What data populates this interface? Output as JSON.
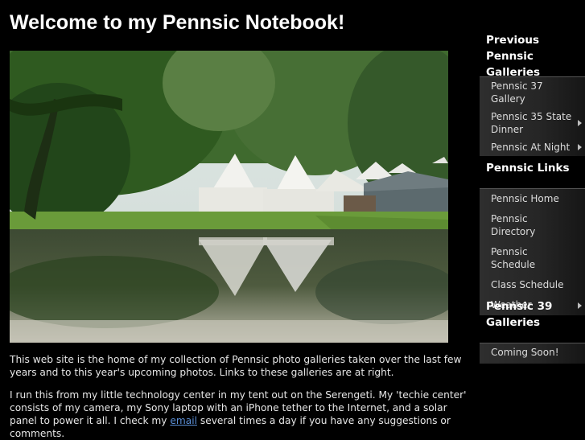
{
  "page": {
    "title": "Welcome to my Pennsic Notebook!",
    "photo_description": "Medieval tents reflected in a pond"
  },
  "intro": {
    "paragraph1": "This web site is the home of my collection of Pennsic photo galleries taken over the last few years and to this year's upcoming photos. Links to these galleries are at right.",
    "paragraph2_before_link": "I run this from my little technology center in my tent out on the Serengeti. My 'techie center' consists of my camera, my Sony laptop with an iPhone tether to the Internet, and a solar panel to power it all. I check my ",
    "paragraph2_link": "email",
    "paragraph2_after_link": " several times a day if you have any suggestions or comments."
  },
  "sidebar": {
    "previous_galleries": {
      "heading": "Previous Pennsic Galleries",
      "items": [
        {
          "label": "Pennsic 37 Gallery",
          "has_submenu": false
        },
        {
          "label": "Pennsic 35 State Dinner",
          "has_submenu": true
        },
        {
          "label": "Pennsic At Night",
          "has_submenu": true
        }
      ]
    },
    "links": {
      "heading": "Pennsic Links",
      "items": [
        {
          "label": "Pennsic Home",
          "has_submenu": false
        },
        {
          "label": "Pennsic Directory",
          "has_submenu": false
        },
        {
          "label": "Pennsic Schedule",
          "has_submenu": false
        },
        {
          "label": "Class Schedule",
          "has_submenu": false
        },
        {
          "label": "Weather",
          "has_submenu": true
        }
      ]
    },
    "p39_galleries": {
      "heading": "Pennsic 39 Galleries",
      "items": [
        {
          "label": "Coming Soon!",
          "has_submenu": false
        }
      ]
    }
  },
  "colors": {
    "background": "#000000",
    "text": "#e6e6e6",
    "link": "#5b8fd6",
    "menu_bg": "#2e2e2e"
  }
}
